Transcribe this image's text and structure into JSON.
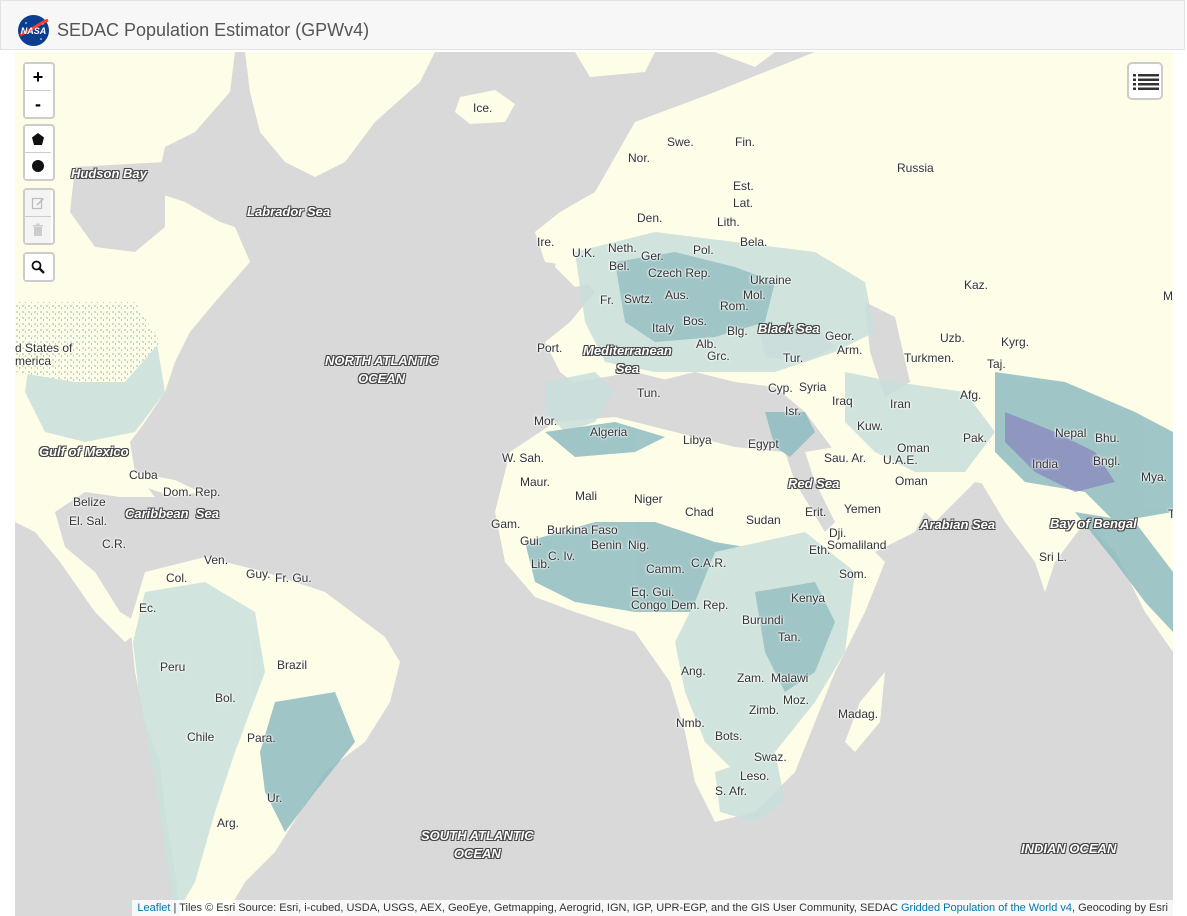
{
  "header": {
    "title": "SEDAC Population Estimator (GPWv4)",
    "logo_text": "NASA"
  },
  "controls": {
    "zoom_in": "+",
    "zoom_out": "-"
  },
  "map_labels": [
    {
      "id": "ice",
      "text": "Ice."
    },
    {
      "id": "swe",
      "text": "Swe."
    },
    {
      "id": "fin",
      "text": "Fin."
    },
    {
      "id": "nor",
      "text": "Nor."
    },
    {
      "id": "est",
      "text": "Est."
    },
    {
      "id": "lat",
      "text": "Lat."
    },
    {
      "id": "russia",
      "text": "Russia"
    },
    {
      "id": "den",
      "text": "Den."
    },
    {
      "id": "lith",
      "text": "Lith."
    },
    {
      "id": "ire",
      "text": "Ire."
    },
    {
      "id": "uk",
      "text": "U.K."
    },
    {
      "id": "neth",
      "text": "Neth."
    },
    {
      "id": "ger",
      "text": "Ger."
    },
    {
      "id": "pol",
      "text": "Pol."
    },
    {
      "id": "bela",
      "text": "Bela."
    },
    {
      "id": "bel",
      "text": "Bel."
    },
    {
      "id": "czech",
      "text": "Czech Rep."
    },
    {
      "id": "ukraine",
      "text": "Ukraine"
    },
    {
      "id": "fr",
      "text": "Fr."
    },
    {
      "id": "swtz",
      "text": "Swtz."
    },
    {
      "id": "aus",
      "text": "Aus."
    },
    {
      "id": "mol",
      "text": "Mol."
    },
    {
      "id": "rom",
      "text": "Rom."
    },
    {
      "id": "kaz",
      "text": "Kaz."
    },
    {
      "id": "mo",
      "text": "Mo"
    },
    {
      "id": "bos",
      "text": "Bos."
    },
    {
      "id": "italy",
      "text": "Italy"
    },
    {
      "id": "blg",
      "text": "Blg."
    },
    {
      "id": "geor",
      "text": "Geor."
    },
    {
      "id": "uzb",
      "text": "Uzb."
    },
    {
      "id": "kyrg",
      "text": "Kyrg."
    },
    {
      "id": "port",
      "text": "Port."
    },
    {
      "id": "alb",
      "text": "Alb."
    },
    {
      "id": "arm",
      "text": "Arm."
    },
    {
      "id": "grc",
      "text": "Grc."
    },
    {
      "id": "tur",
      "text": "Tur."
    },
    {
      "id": "turkmen",
      "text": "Turkmen."
    },
    {
      "id": "taj",
      "text": "Taj."
    },
    {
      "id": "usa",
      "text": "d States of\nmerica"
    },
    {
      "id": "tun",
      "text": "Tun."
    },
    {
      "id": "cyp",
      "text": "Cyp."
    },
    {
      "id": "syria",
      "text": "Syria"
    },
    {
      "id": "isr",
      "text": "Isr."
    },
    {
      "id": "iraq",
      "text": "Iraq"
    },
    {
      "id": "iran",
      "text": "Iran"
    },
    {
      "id": "afg",
      "text": "Afg."
    },
    {
      "id": "mor",
      "text": "Mor."
    },
    {
      "id": "algeria",
      "text": "Algeria"
    },
    {
      "id": "libya",
      "text": "Libya"
    },
    {
      "id": "egypt",
      "text": "Egypt"
    },
    {
      "id": "kuw",
      "text": "Kuw."
    },
    {
      "id": "pak",
      "text": "Pak."
    },
    {
      "id": "nepal",
      "text": "Nepal"
    },
    {
      "id": "bhu",
      "text": "Bhu."
    },
    {
      "id": "oman1",
      "text": "Oman"
    },
    {
      "id": "uae",
      "text": "U.A.E."
    },
    {
      "id": "wsah",
      "text": "W. Sah."
    },
    {
      "id": "sauar",
      "text": "Sau. Ar."
    },
    {
      "id": "india",
      "text": "India"
    },
    {
      "id": "bngl",
      "text": "Bngl."
    },
    {
      "id": "cuba",
      "text": "Cuba"
    },
    {
      "id": "maur",
      "text": "Maur."
    },
    {
      "id": "mali",
      "text": "Mali"
    },
    {
      "id": "niger",
      "text": "Niger"
    },
    {
      "id": "oman2",
      "text": "Oman"
    },
    {
      "id": "mya",
      "text": "Mya."
    },
    {
      "id": "domrep",
      "text": "Dom. Rep."
    },
    {
      "id": "belize",
      "text": "Belize"
    },
    {
      "id": "chad",
      "text": "Chad"
    },
    {
      "id": "erit",
      "text": "Erit."
    },
    {
      "id": "yemen",
      "text": "Yemen"
    },
    {
      "id": "elsal",
      "text": "El. Sal."
    },
    {
      "id": "gam",
      "text": "Gam."
    },
    {
      "id": "burkina",
      "text": "Burkina Faso"
    },
    {
      "id": "sudan",
      "text": "Sudan"
    },
    {
      "id": "tha",
      "text": "Tha"
    },
    {
      "id": "gui",
      "text": "Gui."
    },
    {
      "id": "benin",
      "text": "Benin"
    },
    {
      "id": "nig",
      "text": "Nig."
    },
    {
      "id": "dji",
      "text": "Dji."
    },
    {
      "id": "cr",
      "text": "C.R."
    },
    {
      "id": "somaliland",
      "text": "Somaliland"
    },
    {
      "id": "eth",
      "text": "Eth."
    },
    {
      "id": "cotiv",
      "text": "C. Iv."
    },
    {
      "id": "lib",
      "text": "Lib."
    },
    {
      "id": "srl",
      "text": "Sri L."
    },
    {
      "id": "ven",
      "text": "Ven."
    },
    {
      "id": "guy",
      "text": "Guy."
    },
    {
      "id": "frgu",
      "text": "Fr. Gu."
    },
    {
      "id": "camm",
      "text": "Camm."
    },
    {
      "id": "car",
      "text": "C.A.R."
    },
    {
      "id": "som",
      "text": "Som."
    },
    {
      "id": "col",
      "text": "Col."
    },
    {
      "id": "eqgui",
      "text": "Eq. Gui."
    },
    {
      "id": "kenya",
      "text": "Kenya"
    },
    {
      "id": "ec",
      "text": "Ec."
    },
    {
      "id": "congo",
      "text": "Congo"
    },
    {
      "id": "demrep",
      "text": "Dem. Rep."
    },
    {
      "id": "burundi",
      "text": "Burundi"
    },
    {
      "id": "tan",
      "text": "Tan."
    },
    {
      "id": "peru",
      "text": "Peru"
    },
    {
      "id": "brazil",
      "text": "Brazil"
    },
    {
      "id": "ang",
      "text": "Ang."
    },
    {
      "id": "zam",
      "text": "Zam."
    },
    {
      "id": "malawi",
      "text": "Malawi"
    },
    {
      "id": "bol",
      "text": "Bol."
    },
    {
      "id": "zimb",
      "text": "Zimb."
    },
    {
      "id": "moz",
      "text": "Moz."
    },
    {
      "id": "madag",
      "text": "Madag."
    },
    {
      "id": "nmb",
      "text": "Nmb."
    },
    {
      "id": "chile",
      "text": "Chile"
    },
    {
      "id": "para",
      "text": "Para."
    },
    {
      "id": "bots",
      "text": "Bots."
    },
    {
      "id": "swaz",
      "text": "Swaz."
    },
    {
      "id": "leso",
      "text": "Leso."
    },
    {
      "id": "safr",
      "text": "S. Afr."
    },
    {
      "id": "ur",
      "text": "Ur."
    },
    {
      "id": "arg",
      "text": "Arg."
    }
  ],
  "water_labels": [
    {
      "id": "hudson",
      "text": "Hudson Bay"
    },
    {
      "id": "labrador",
      "text": "Labrador Sea"
    },
    {
      "id": "northatl",
      "text": "NORTH ATLANTIC\nOCEAN"
    },
    {
      "id": "blacksea",
      "text": "Black Sea"
    },
    {
      "id": "medsea",
      "text": "Mediterranean\nSea"
    },
    {
      "id": "gulfmex",
      "text": "Gulf of Mexico"
    },
    {
      "id": "redsea",
      "text": "Red Sea"
    },
    {
      "id": "arabian",
      "text": "Arabian Sea"
    },
    {
      "id": "bengal",
      "text": "Bay of Bengal"
    },
    {
      "id": "caribbean",
      "text": "Caribbean  Sea"
    },
    {
      "id": "southatl",
      "text": "SOUTH ATLANTIC\nOCEAN"
    },
    {
      "id": "indian",
      "text": "INDIAN OCEAN"
    }
  ],
  "attribution": {
    "leaflet": "Leaflet",
    "sep": " | ",
    "tiles": "Tiles © Esri Source: Esri, i-cubed, USDA, USGS, AEX, GeoEye, Getmapping, Aerogrid, IGN, IGP, UPR-EGP, and the GIS User Community, SEDAC ",
    "gpw": "Gridded Population of the World v4",
    "geocoding": ", Geocoding by Esri"
  },
  "colors": {
    "water": "#d9d9d9",
    "land_low": "#fdfde8",
    "pop_light": "#c9e0dc",
    "pop_mid": "#8fbcc1",
    "pop_high": "#5a8fa8",
    "pop_dense": "#6f63b8",
    "link": "#0078a8"
  }
}
